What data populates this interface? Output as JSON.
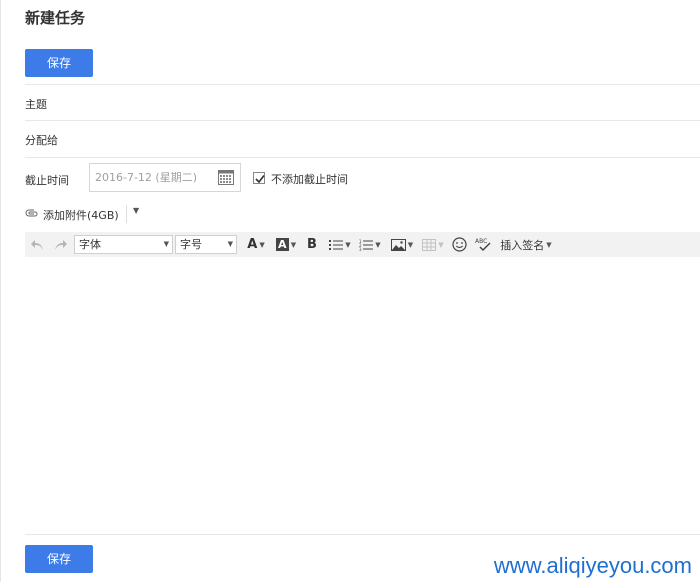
{
  "page": {
    "title": "新建任务"
  },
  "actions": {
    "save_label": "保存"
  },
  "fields": {
    "subject_label": "主题",
    "assign_label": "分配给",
    "deadline_label": "截止时间",
    "deadline_placeholder": "2016-7-12 (星期二)",
    "no_deadline_label": "不添加截止时间",
    "no_deadline_checked": true
  },
  "attachment": {
    "label": "添加附件(4GB)"
  },
  "toolbar": {
    "font_family": "字体",
    "font_size": "字号",
    "insert_signature": "插入签名",
    "icons": [
      "undo-icon",
      "redo-icon",
      "font-color-icon",
      "highlight-icon",
      "bold-icon",
      "bullet-list-icon",
      "numbered-list-icon",
      "image-icon",
      "table-icon",
      "emoji-icon",
      "spellcheck-icon"
    ]
  },
  "watermark": {
    "text": "www.aliqiyeyou.com",
    "color": "#1f6fd0"
  },
  "colors": {
    "primary": "#3d7be8",
    "toolbar_bg": "#f2f2f2"
  }
}
